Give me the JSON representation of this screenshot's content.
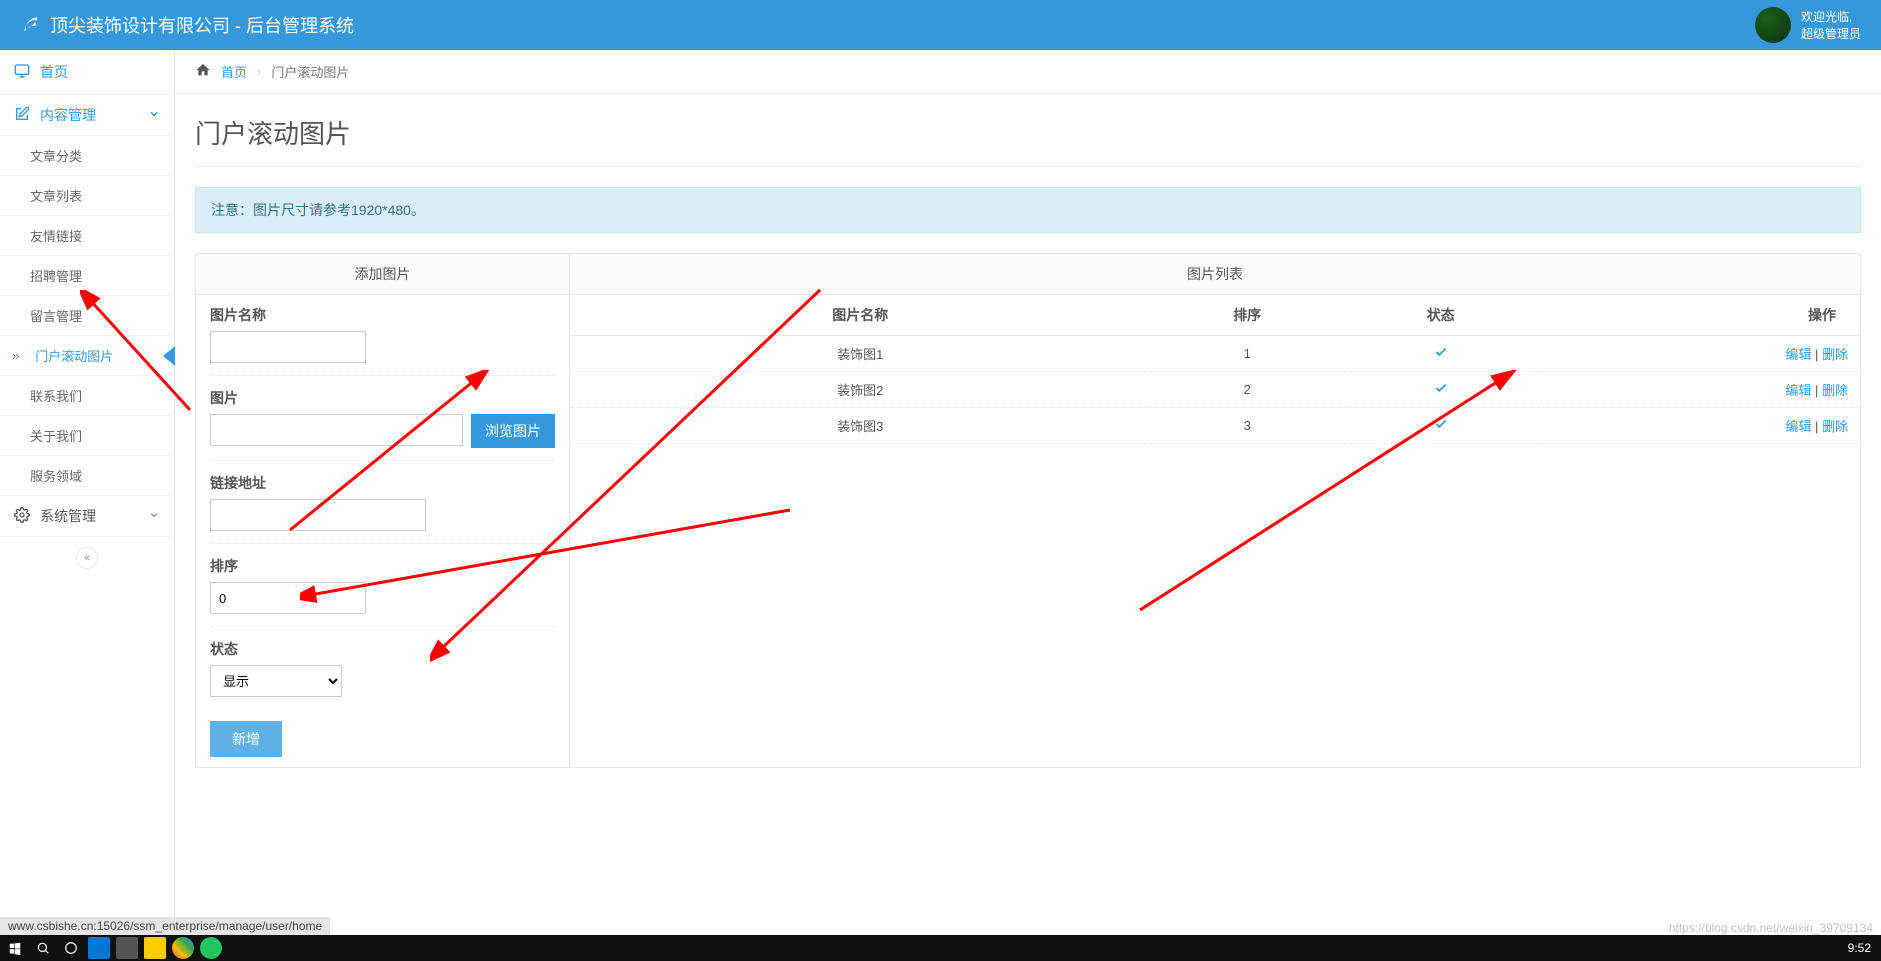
{
  "header": {
    "title": "顶尖装饰设计有限公司 - 后台管理系统",
    "welcome": "欢迎光临,",
    "user": "超级管理员"
  },
  "sidebar": {
    "home": "首页",
    "content_mgmt": "内容管理",
    "items": [
      "文章分类",
      "文章列表",
      "友情链接",
      "招聘管理",
      "留言管理",
      "门户滚动图片",
      "联系我们",
      "关于我们",
      "服务领域"
    ],
    "system_mgmt": "系统管理"
  },
  "breadcrumb": {
    "home": "首页",
    "current": "门户滚动图片"
  },
  "page": {
    "title": "门户滚动图片",
    "notice": "注意：图片尺寸请参考1920*480。"
  },
  "form": {
    "header": "添加图片",
    "labels": {
      "name": "图片名称",
      "image": "图片",
      "browse": "浏览图片",
      "link": "链接地址",
      "sort": "排序",
      "status": "状态"
    },
    "sort_value": "0",
    "status_option": "显示",
    "submit": "新增"
  },
  "list": {
    "header": "图片列表",
    "columns": {
      "name": "图片名称",
      "sort": "排序",
      "status": "状态",
      "action": "操作"
    },
    "rows": [
      {
        "name": "装饰图1",
        "sort": "1"
      },
      {
        "name": "装饰图2",
        "sort": "2"
      },
      {
        "name": "装饰图3",
        "sort": "3"
      }
    ],
    "edit": "编辑",
    "delete": "删除",
    "sep": " | "
  },
  "status_url": "www.csbishe.cn:15026/ssm_enterprise/manage/user/home",
  "watermark": "https://blog.csdn.net/weixin_39709134",
  "time": "9:52"
}
